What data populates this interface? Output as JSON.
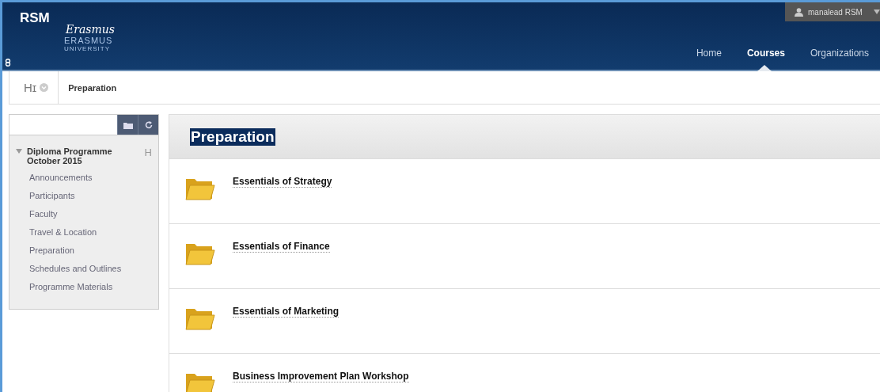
{
  "header": {
    "logo": {
      "brand": "RSM",
      "script": "Erasmus",
      "name": "ERASMUS",
      "sub": "UNIVERSITY"
    },
    "user": {
      "name": "manalead RSM"
    },
    "nav": [
      {
        "label": "Home",
        "selected": false
      },
      {
        "label": "Courses",
        "selected": true
      },
      {
        "label": "Organizations",
        "selected": false
      }
    ]
  },
  "breadcrumb": {
    "home": "Hɪ",
    "current": "Preparation"
  },
  "sidebar": {
    "course": {
      "title": "Diploma Programme October 2015",
      "expanded": true,
      "hint": "H"
    },
    "items": [
      "Announcements",
      "Participants",
      "Faculty",
      "Travel & Location",
      "Preparation",
      "Schedules and Outlines",
      "Programme Materials"
    ]
  },
  "content": {
    "title": "Preparation",
    "items": [
      {
        "title": "Essentials of Strategy"
      },
      {
        "title": "Essentials of Finance"
      },
      {
        "title": "Essentials of Marketing"
      },
      {
        "title": "Business Improvement Plan Workshop"
      }
    ]
  }
}
